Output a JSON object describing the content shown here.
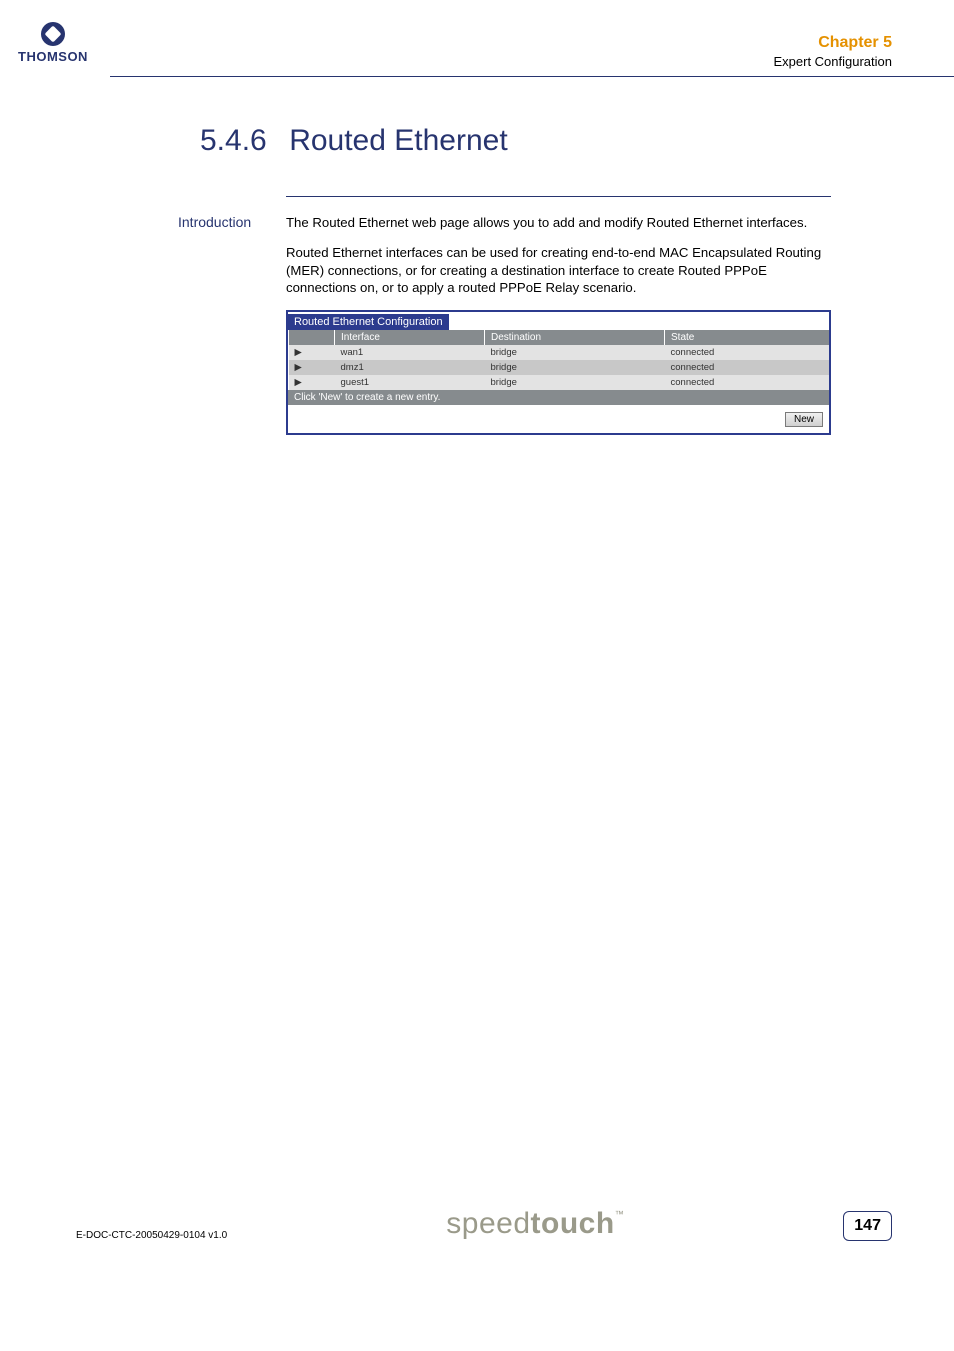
{
  "header": {
    "brand": "THOMSON",
    "chapter": "Chapter 5",
    "chapter_sub": "Expert Configuration"
  },
  "section": {
    "number": "5.4.6",
    "title": "Routed Ethernet"
  },
  "intro": {
    "label": "Introduction",
    "p1": "The Routed Ethernet web page allows you to add and modify Routed Ethernet interfaces.",
    "p2": "Routed Ethernet interfaces can be used for creating end-to-end MAC Encapsulated Routing (MER) connections, or for creating a destination interface to create Routed PPPoE connections on, or to apply a routed PPPoE Relay scenario."
  },
  "config": {
    "title": "Routed Ethernet Configuration",
    "columns": {
      "c0": "",
      "c1": "Interface",
      "c2": "Destination",
      "c3": "State"
    },
    "rows": [
      {
        "arrow": "▶",
        "interface": "wan1",
        "destination": "bridge",
        "state": "connected"
      },
      {
        "arrow": "▶",
        "interface": "dmz1",
        "destination": "bridge",
        "state": "connected"
      },
      {
        "arrow": "▶",
        "interface": "guest1",
        "destination": "bridge",
        "state": "connected"
      }
    ],
    "hint": "Click 'New' to create a new entry.",
    "new_button": "New"
  },
  "footer": {
    "doc_id": "E-DOC-CTC-20050429-0104 v1.0",
    "logo_a": "speed",
    "logo_b": "touch",
    "tm": "™",
    "page": "147"
  }
}
